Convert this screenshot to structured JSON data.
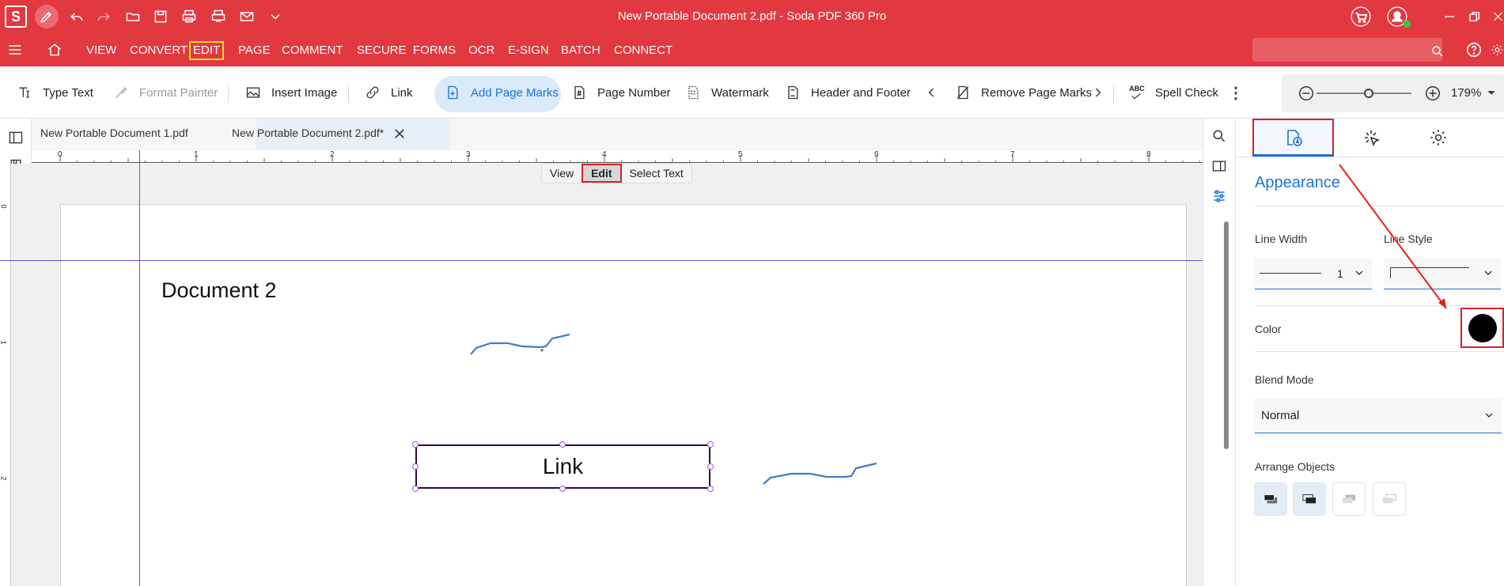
{
  "app": {
    "title": "New Portable Document 2.pdf   -   Soda PDF 360 Pro",
    "logo": "S"
  },
  "quick_access": [
    "pen-icon",
    "undo-icon",
    "redo-icon",
    "open-icon",
    "save-icon",
    "print-icon",
    "print-setup-icon",
    "email-icon",
    "more-icon"
  ],
  "menu": {
    "items": [
      "VIEW",
      "CONVERT",
      "EDIT",
      "PAGE",
      "COMMENT",
      "SECURE",
      "FORMS",
      "OCR",
      "E-SIGN",
      "BATCH",
      "CONNECT"
    ],
    "active": "EDIT"
  },
  "search": {
    "placeholder": ""
  },
  "toolbar": {
    "type_text": "Type Text",
    "format_painter": "Format Painter",
    "insert_image": "Insert Image",
    "link": "Link",
    "add_page_marks": "Add Page Marks",
    "page_number": "Page Number",
    "watermark": "Watermark",
    "header_footer": "Header and Footer",
    "remove_page_marks": "Remove Page Marks",
    "spell_check": "Spell Check",
    "zoom": "179%"
  },
  "doc_tabs": [
    {
      "label": "New Portable Document 1.pdf"
    },
    {
      "label": "New Portable Document 2.pdf*"
    }
  ],
  "ruler": [
    "0",
    "1",
    "2",
    "3",
    "4",
    "5",
    "6",
    "7",
    "8"
  ],
  "mode_switch": {
    "view": "View",
    "edit": "Edit",
    "select_text": "Select Text"
  },
  "document": {
    "heading": "Document 2",
    "link_text": "Link"
  },
  "panel": {
    "section_title": "Appearance",
    "line_width_label": "Line Width",
    "line_width_value": "1",
    "line_style_label": "Line Style",
    "color_label": "Color",
    "color_value": "#000000",
    "blend_mode_label": "Blend Mode",
    "blend_mode_value": "Normal",
    "arrange_label": "Arrange Objects"
  },
  "colors": {
    "brand": "#e2383f",
    "accent": "#1a73d9",
    "highlight_border": "#d9202a",
    "menu_highlight": "#f5e21b",
    "annotation_line": "#3e7fc1"
  }
}
